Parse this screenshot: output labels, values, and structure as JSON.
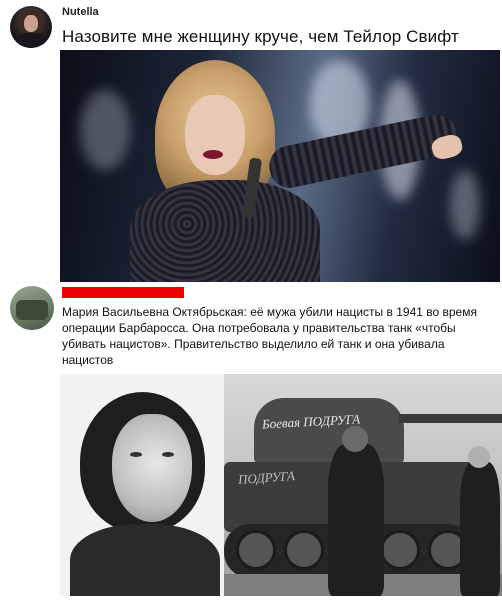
{
  "post1": {
    "username": "Nutella",
    "title": "Назовите мне женщину круче, чем Тейлор Свифт",
    "avatar_icon": "user-avatar",
    "photo_icon": "concert-singer-photo"
  },
  "post2": {
    "avatar_icon": "user-avatar",
    "redaction_color": "#ee0000",
    "text": "Мария Васильевна Октябрьская: её мужа убили нацисты в 1941 во время операции Барбаросса. Она потребовала у правительства танк «чтобы убивать нацистов». Правительство выделило ей танк и она убивала нацистов",
    "photo_portrait_icon": "portrait-photo",
    "photo_tank_icon": "tank-photo",
    "tank_inscription": "Боевая ПОДРУГА",
    "tank_inscription_hull": "ПОДРУГА"
  }
}
